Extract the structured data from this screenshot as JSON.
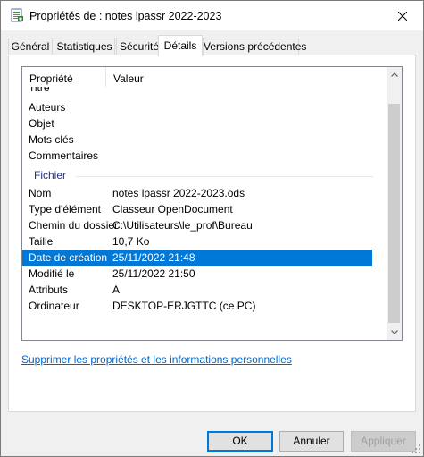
{
  "window": {
    "title": "Propriétés de : notes lpassr 2022-2023"
  },
  "tabs": [
    {
      "label": "Général",
      "active": false
    },
    {
      "label": "Statistiques",
      "active": false
    },
    {
      "label": "Sécurité",
      "active": false
    },
    {
      "label": "Détails",
      "active": true
    },
    {
      "label": "Versions précédentes",
      "active": false
    }
  ],
  "list": {
    "header": {
      "property": "Propriété",
      "value": "Valeur"
    },
    "clipped_row": "Titre",
    "description_rows": [
      {
        "property": "Auteurs",
        "value": ""
      },
      {
        "property": "Objet",
        "value": ""
      },
      {
        "property": "Mots clés",
        "value": ""
      },
      {
        "property": "Commentaires",
        "value": ""
      }
    ],
    "group_label": "Fichier",
    "file_rows": [
      {
        "property": "Nom",
        "value": "notes lpassr 2022-2023.ods"
      },
      {
        "property": "Type d'élément",
        "value": "Classeur OpenDocument"
      },
      {
        "property": "Chemin du dossier",
        "value": "C:\\Utilisateurs\\le_prof\\Bureau"
      },
      {
        "property": "Taille",
        "value": "10,7 Ko"
      },
      {
        "property": "Date de création",
        "value": "25/11/2022 21:48"
      },
      {
        "property": "Modifié le",
        "value": "25/11/2022 21:50"
      },
      {
        "property": "Attributs",
        "value": "A"
      },
      {
        "property": "Ordinateur",
        "value": "DESKTOP-ERJGTTC (ce PC)"
      }
    ],
    "selected_row": "Date de création"
  },
  "remove_link": "Supprimer les propriétés et les informations personnelles",
  "buttons": {
    "ok": "OK",
    "cancel": "Annuler",
    "apply": "Appliquer"
  },
  "colors": {
    "selection": "#0078d7",
    "link": "#0066cc",
    "group": "#1e3287"
  }
}
